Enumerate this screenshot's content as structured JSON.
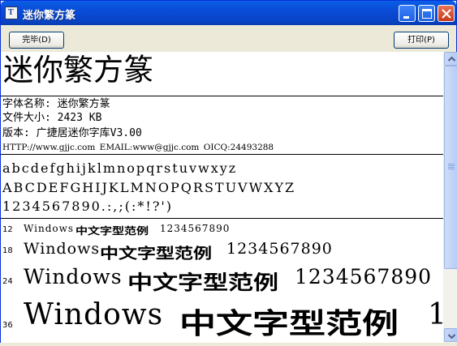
{
  "window": {
    "title": "迷你繁方篆",
    "app_icon": "font-file-icon",
    "icon_letter": "T",
    "controls": [
      "minimize-icon",
      "maximize-icon",
      "close-icon"
    ]
  },
  "toolbar": {
    "done_label": "完毕(D)",
    "print_label": "打印(P)"
  },
  "font_info": {
    "display_name": "迷你繁方篆",
    "name_line": "字体名称: 迷你繁方篆",
    "size_line": "文件大小: 2423 KB",
    "version_line": "版本: 广捷居迷你字库V3.00",
    "contact_line": "HTTP://www.gjjc.com  EMAIL:www@gjjc.com  OICQ:24493288"
  },
  "charset_samples": {
    "lowercase": "abcdefghijklmnopqrstuvwxyz",
    "uppercase": "ABCDEFGHIJKLMNOPQRSTUVWXYZ",
    "digits": "1234567890.:,;(:*!?')"
  },
  "size_samples": [
    {
      "size": "12",
      "latin": "Windows",
      "seal": "中文字型范例",
      "digits": "1234567890"
    },
    {
      "size": "18",
      "latin": "Windows",
      "seal": "中文字型范例",
      "digits": "1234567890"
    },
    {
      "size": "24",
      "latin": "Windows",
      "seal": "中文字型范例",
      "digits": "1234567890"
    },
    {
      "size": "36",
      "latin": "Windows",
      "seal": "中文字型范例",
      "digits": "1"
    }
  ]
}
